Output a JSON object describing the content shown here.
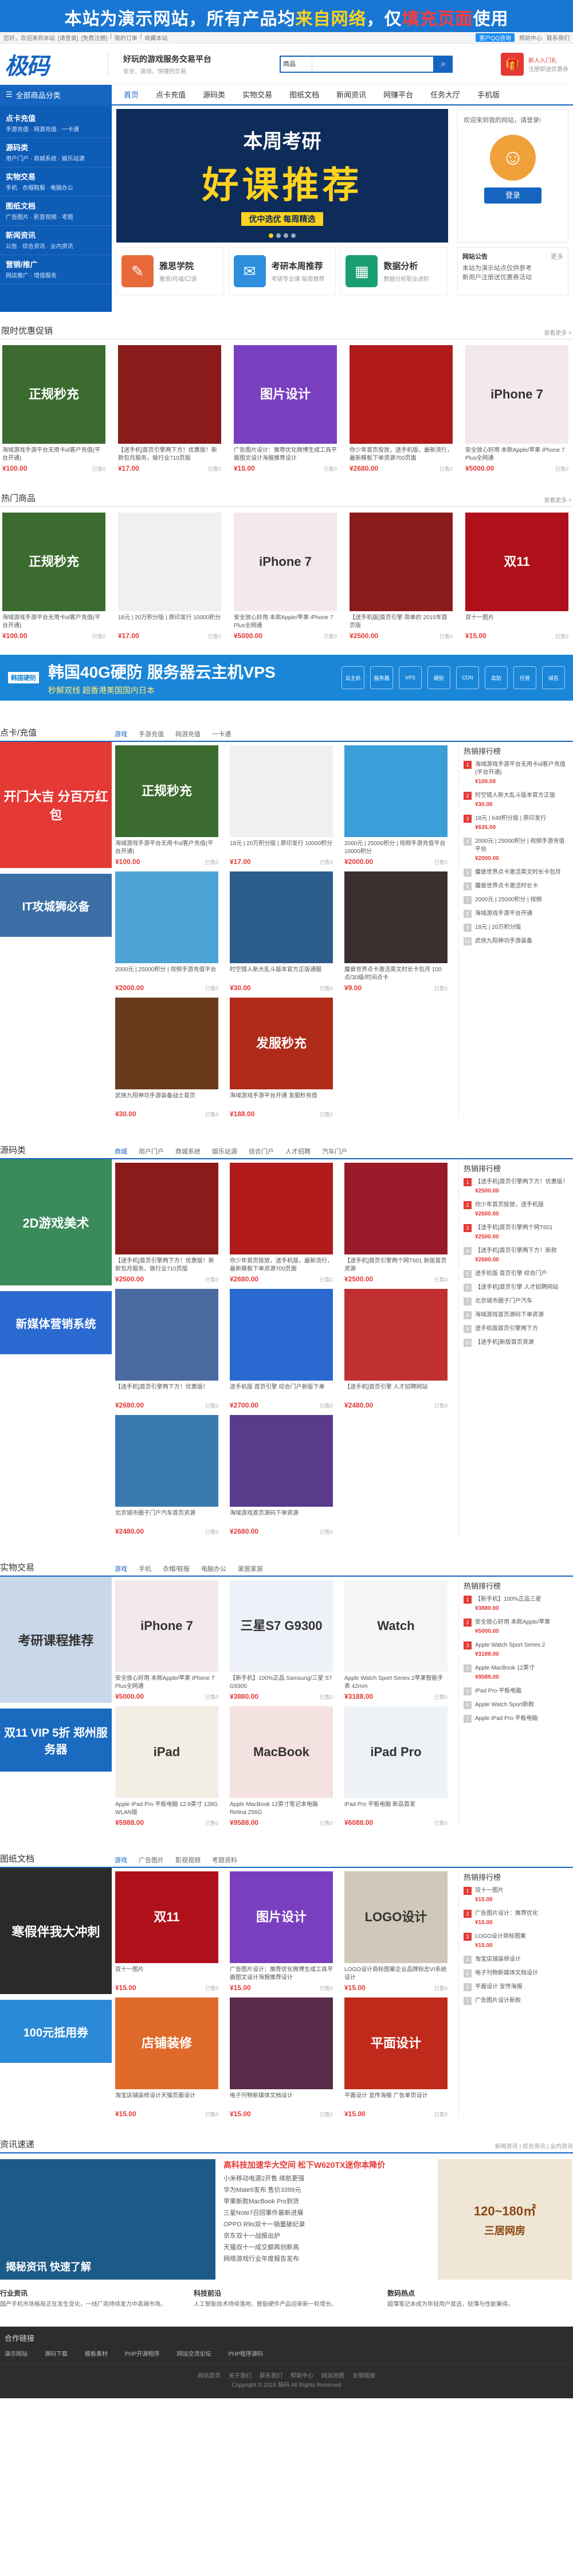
{
  "top_banner": {
    "part1": "本站为演示网站，所有产品均",
    "part2": "来自网络",
    "part3": "，仅",
    "part4": "填充页面",
    "part5": "使用"
  },
  "topbar": {
    "left": [
      "您好，欢迎来到本站",
      "[请登录]",
      "[免费注册]",
      "|",
      "我的订单",
      "|",
      "收藏本站"
    ],
    "qq_label": "客户QQ咨询",
    "right": [
      "帮助中心",
      "联系我们"
    ]
  },
  "header": {
    "logo": "极码",
    "slogan_title": "好玩的游戏服务交易平台",
    "slogan_sub": "安全、高效、快捷的交易",
    "search_select": "商品",
    "search_placeholder": "",
    "search_icon": "search-icon",
    "gift_label": "新人入门礼",
    "gift_sub": "注册即送优惠券"
  },
  "nav": {
    "category_label": "全部商品分类",
    "items": [
      "首页",
      "点卡充值",
      "源码类",
      "实物交易",
      "图纸文档",
      "新闻资讯",
      "网赚平台",
      "任务大厅",
      "手机版"
    ]
  },
  "sidecat": [
    {
      "title": "点卡充值",
      "sub": "手游充值 · 网游充值 · 一卡通"
    },
    {
      "title": "源码类",
      "sub": "用户门户 · 商城系统 · 娱乐站源"
    },
    {
      "title": "实物交易",
      "sub": "手机 · 衣帽鞋服 · 电脑办公"
    },
    {
      "title": "图纸文档",
      "sub": "广告图片 · 影音视频 · 考题"
    },
    {
      "title": "新闻资讯",
      "sub": "公告 · 综合资讯 · 业内资讯"
    },
    {
      "title": "营销/推广",
      "sub": "网店推广 · 增值服务"
    }
  ],
  "hero": {
    "line1": "本周考研",
    "line2": "好课推荐",
    "line3": "优中选优 每周精选",
    "tiles": [
      {
        "title": "雅思学院",
        "sub": "雅思/托福/口语",
        "color": "#e86a3a",
        "icon": "✎"
      },
      {
        "title": "考研本周推荐",
        "sub": "考研专业课 每周推荐",
        "color": "#2d8fde",
        "icon": "✉"
      },
      {
        "title": "数据分析",
        "sub": "数据分析职业进阶",
        "color": "#1a9e73",
        "icon": "▦"
      }
    ],
    "login_welcome": "欢迎来到我的网站，请登录!",
    "login_button": "登录",
    "notice_title": "网站公告",
    "notice_more": "更多",
    "notices": [
      "本站为演示站点仅供参考",
      "新用户注册送优惠券活动"
    ]
  },
  "limited": {
    "title": "限时优惠促销",
    "more": "查看更多 >",
    "items": [
      {
        "title": "海域游戏手游平台无用卡id客户充值(平台开通)",
        "price": "¥100.00",
        "sold": "已售0",
        "bg": "#3b6b2f",
        "label": "正规秒充"
      },
      {
        "title": "【送手机]首页引擎两下方！优惠版！新款包月服务，做行业710页版",
        "price": "¥17.00",
        "sold": "已售0",
        "bg": "#8b1a1a",
        "label": ""
      },
      {
        "title": "广告图片设计：推荐优化微博生成工具平面图文设计海报推荐设计",
        "price": "¥15.00",
        "sold": "已售0",
        "bg": "#7a3fbf",
        "label": "图片设计"
      },
      {
        "title": "你少年首页投放，送手机版，最新流行，最新模板下单资源700页面",
        "price": "¥2680.00",
        "sold": "已售0",
        "bg": "#b01a1a",
        "label": ""
      },
      {
        "title": "安全放心好用 本款Apple/苹果 iPhone 7 Plus全网通",
        "price": "¥5000.00",
        "sold": "已售0",
        "bg": "#f3e9ea",
        "label": "iPhone 7"
      }
    ]
  },
  "hot": {
    "title": "热门商品",
    "more": "查看更多 >",
    "items": [
      {
        "title": "海域游戏手游平台无用卡id客户充值(平台开通)",
        "price": "¥100.00",
        "sold": "已售0",
        "bg": "#3b6b2f",
        "label": "正规秒充"
      },
      {
        "title": "18元 | 20万积分版 | 原印发行 10000积分",
        "price": "¥17.00",
        "sold": "已售0",
        "bg": "#f0f0f0",
        "label": ""
      },
      {
        "title": "安全放心好用 本款Apple/苹果 iPhone 7 Plus全网通",
        "price": "¥5000.00",
        "sold": "已售0",
        "bg": "#f3e9ea",
        "label": "iPhone 7"
      },
      {
        "title": "【送手机版]首页引擎 简单的 2015年首页版",
        "price": "¥2500.00",
        "sold": "已售0",
        "bg": "#8b1a1a",
        "label": ""
      },
      {
        "title": "双十一图片",
        "price": "¥15.00",
        "sold": "已售0",
        "bg": "#b0101a",
        "label": "双11"
      }
    ]
  },
  "ad": {
    "tag": "韩国硬防",
    "big": "韩国40G硬防 服务器云主机VPS",
    "sub": "秒解双线 超香港美国国内日本",
    "icons": [
      "云主机",
      "服务器",
      "VPS",
      "硬防",
      "CDN",
      "高防",
      "托管",
      "域名"
    ]
  },
  "block_card": {
    "title": "点卡/充值",
    "tabs": [
      "游戏",
      "手游充值",
      "网游充值",
      "一卡通"
    ],
    "left1": "开门大吉 分百万红包",
    "left2": "IT攻城狮必备",
    "left1_bg": "#e53935",
    "left2_bg": "#3a6ea5",
    "items": [
      {
        "title": "海域游戏手游平台无用卡id客户充值(平台开通)",
        "price": "¥100.00",
        "sold": "已售0",
        "bg": "#3b6b2f",
        "label": "正规秒充"
      },
      {
        "title": "18元 | 20万积分版 | 原印发行 10000积分",
        "price": "¥17.00",
        "sold": "已售0",
        "bg": "#f0f0f0",
        "label": ""
      },
      {
        "title": "2000元 | 25000积分 | 视频手游充值平台 10000积分",
        "price": "¥2000.00",
        "sold": "已售0",
        "bg": "#3a9ed8",
        "label": ""
      },
      {
        "title": "2000元 | 25000积分 | 视频手游充值平台",
        "price": "¥2000.00",
        "sold": "已售0",
        "bg": "#4da3d6",
        "label": ""
      },
      {
        "title": "时空猎人新大乱斗版本官方正版通服",
        "price": "¥30.00",
        "sold": "已售0",
        "bg": "#2d5d8a",
        "label": ""
      },
      {
        "title": "魔兽世界点卡激活英文时长卡包月 100点/30级/时间点卡",
        "price": "¥9.00",
        "sold": "已售0",
        "bg": "#3a3030",
        "label": ""
      },
      {
        "title": "武侠九阳神功手游装备战士首页",
        "price": "¥30.00",
        "sold": "已售0",
        "bg": "#6a3a1a",
        "label": ""
      },
      {
        "title": "海域游戏手游平台开通 发服秒充值",
        "price": "¥188.00",
        "sold": "已售0",
        "bg": "#b02a1a",
        "label": "发服秒充"
      }
    ],
    "rank_title": "热销排行榜",
    "ranks": [
      {
        "name": "海域游戏手游平台无用卡id客户充值(平台开通)",
        "price": "¥100.00"
      },
      {
        "name": "时空猎人新大乱斗版本官方正版",
        "price": "¥30.00"
      },
      {
        "name": "18元 | 648积分版 | 原印发行",
        "price": "¥635.00"
      },
      {
        "name": "2000元 | 25000积分 | 视频手游充值平台",
        "price": "¥2000.00"
      },
      {
        "name": "魔兽世界点卡激活英文时长卡包月"
      },
      {
        "name": "魔兽世界点卡激活时长卡"
      },
      {
        "name": "2000元 | 25000积分 | 视频"
      },
      {
        "name": "海域游戏手游平台开通"
      },
      {
        "name": "18元 | 20万积分版"
      },
      {
        "name": "武侠九阳神功手游装备"
      }
    ]
  },
  "block_source": {
    "title": "源码类",
    "tabs": [
      "商城",
      "用户门户",
      "商城系统",
      "娱乐站源",
      "综合门户",
      "人才招聘",
      "汽车门户"
    ],
    "left1": "2D游戏美术",
    "left2": "新媒体营销系统",
    "left1_bg": "#3a8a5a",
    "left2_bg": "#2a6ad0",
    "items": [
      {
        "title": "【送手机]首页引擎两下方！优惠版！新款包月服务，做行业710页版",
        "price": "¥2500.00",
        "sold": "已售0",
        "bg": "#8b1a1a",
        "label": ""
      },
      {
        "title": "你少年首页投放，送手机版，最新流行，最新模板下单资源700页面",
        "price": "¥2680.00",
        "sold": "已售0",
        "bg": "#b01a1a",
        "label": ""
      },
      {
        "title": "【送手机]首页引擎两个网T601 新版首页资源",
        "price": "¥2500.00",
        "sold": "已售0",
        "bg": "#9a1a2a",
        "label": ""
      },
      {
        "title": "【送手机]首页引擎两下方！优惠版！",
        "price": "¥2680.00",
        "sold": "已售0",
        "bg": "#4a6aa0",
        "label": ""
      },
      {
        "title": "送手机版 首页引擎 综合门户新版下单",
        "price": "¥2700.00",
        "sold": "已售0",
        "bg": "#2a6ad0",
        "label": ""
      },
      {
        "title": "【送手机]首页引擎 人才招聘网站",
        "price": "¥2480.00",
        "sold": "已售0",
        "bg": "#c03030",
        "label": ""
      },
      {
        "title": "北京城市圈子门户汽车首页资源",
        "price": "¥2480.00",
        "sold": "已售0",
        "bg": "#3a7ab0",
        "label": ""
      },
      {
        "title": "海域游戏首页源码下单资源",
        "price": "¥2680.00",
        "sold": "已售0",
        "bg": "#5a3a8a",
        "label": ""
      }
    ],
    "rank_title": "热销排行榜",
    "ranks": [
      {
        "name": "【送手机]首页引擎两下方！优惠版！",
        "price": "¥2500.00"
      },
      {
        "name": "你少年首页投放，送手机版",
        "price": "¥2680.00"
      },
      {
        "name": "【送手机]首页引擎两个网T601",
        "price": "¥2500.00"
      },
      {
        "name": "【送手机]首页引擎两下方！新款",
        "price": "¥2680.00"
      },
      {
        "name": "送手机版 首页引擎 综合门户"
      },
      {
        "name": "【送手机]首页引擎 人才招聘网站"
      },
      {
        "name": "北京城市圈子门户汽车"
      },
      {
        "name": "海域游戏首页源码下单资源"
      },
      {
        "name": "送手机版首页引擎两下方"
      },
      {
        "name": "【送手机]新版首页资源"
      }
    ]
  },
  "block_goods": {
    "title": "实物交易",
    "tabs": [
      "游戏",
      "手机",
      "衣帽/鞋服",
      "电脑办公",
      "家居家装"
    ],
    "left1": "考研课程推荐",
    "left2": "双11 VIP 5折 郑州服务器",
    "left1_bg": "#c9d8e8",
    "left2_bg": "#1a6ac0",
    "items": [
      {
        "title": "安全放心好用 本款Apple/苹果 iPhone 7 Plus全网通",
        "price": "¥5000.00",
        "sold": "已售0",
        "bg": "#f3e9ea",
        "label": "iPhone 7"
      },
      {
        "title": "【新手机】100%正品 Samsung/三星 S7 G9300",
        "price": "¥3880.00",
        "sold": "已售0",
        "bg": "#eef1f7",
        "label": "三星S7 G9300"
      },
      {
        "title": "Apple Watch Sport Series 2苹果智能手表 42mm",
        "price": "¥3188.00",
        "sold": "已售0",
        "bg": "#f5f5f5",
        "label": "Watch"
      },
      {
        "title": "Apple iPad Pro 平板电脑 12.9英寸 128G WLAN版",
        "price": "¥5988.00",
        "sold": "已售0",
        "bg": "#f2eee4",
        "label": "iPad"
      },
      {
        "title": "Apple MacBook 12英寸笔记本电脑 Retina 256G",
        "price": "¥9588.00",
        "sold": "已售0",
        "bg": "#f4e2e0",
        "label": "MacBook"
      },
      {
        "title": "iPad Pro 平板电脑 新品首发",
        "price": "¥6088.00",
        "sold": "已售0",
        "bg": "#eef2f6",
        "label": "iPad Pro"
      }
    ],
    "rank_title": "热销排行榜",
    "ranks": [
      {
        "name": "【新手机】100%正品三星",
        "price": "¥3880.00"
      },
      {
        "name": "安全放心好用 本款Apple/苹果",
        "price": "¥5000.00"
      },
      {
        "name": "Apple Watch Sport Series 2",
        "price": "¥3188.00"
      },
      {
        "name": "Apple MacBook 12英寸",
        "price": "¥9588.00"
      },
      {
        "name": "iPad Pro 平板电脑"
      },
      {
        "name": "Apple Watch Sport新款"
      },
      {
        "name": "Apple iPad Pro 平板电脑"
      }
    ]
  },
  "block_docs": {
    "title": "图纸文档",
    "tabs": [
      "游戏",
      "广告图片",
      "影视视频",
      "考题资料"
    ],
    "left1": "寒假伴我大冲刺",
    "left2": "100元抵用券",
    "left1_bg": "#2a2a2a",
    "left2_bg": "#2a8ad8",
    "items": [
      {
        "title": "双十一图片",
        "price": "¥15.00",
        "sold": "已售0",
        "bg": "#b0101a",
        "label": "双11"
      },
      {
        "title": "广告图片设计：推荐优化微博生成工具平面图文设计海报推荐设计",
        "price": "¥15.00",
        "sold": "已售0",
        "bg": "#7a3fbf",
        "label": "图片设计"
      },
      {
        "title": "LOGO设计商标图案企业品牌标志VI系统设计",
        "price": "¥15.00",
        "sold": "已售0",
        "bg": "#d0c8b8",
        "label": "LOGO设计"
      },
      {
        "title": "淘宝店铺装修设计天猫页面设计",
        "price": "¥15.00",
        "sold": "已售0",
        "bg": "#e06a2a",
        "label": "店铺装修"
      },
      {
        "title": "电子刊物新媒体文档设计",
        "price": "¥15.00",
        "sold": "已售0",
        "bg": "#5a2a4a",
        "label": ""
      },
      {
        "title": "平面设计 宣传海报 广告单页设计",
        "price": "¥15.00",
        "sold": "已售0",
        "bg": "#c02a1a",
        "label": "平面设计"
      }
    ],
    "rank_title": "热销排行榜",
    "ranks": [
      {
        "name": "双十一图片",
        "price": "¥15.00"
      },
      {
        "name": "广告图片设计：推荐优化",
        "price": "¥15.00"
      },
      {
        "name": "LOGO设计商标图案",
        "price": "¥15.00"
      },
      {
        "name": "淘宝店铺装修设计"
      },
      {
        "name": "电子刊物新媒体文档设计"
      },
      {
        "name": "平面设计 宣传海报"
      },
      {
        "name": "广告图片设计新款"
      }
    ]
  },
  "news": {
    "title": "资讯速递",
    "more": "新闻资讯 | 综合资讯 | 业内资讯",
    "img_caption": "揭秘资讯 快速了解",
    "headline": "高科技加速华大空间 松下W620TX迷你本降价",
    "list": [
      "小米移动电源2开售 续航更强",
      "华为Mate9发布 售价3399元",
      "苹果新款MacBook Pro到货",
      "三星Note7召回事件最新进展",
      "OPPO R9s双十一销量破纪录",
      "京东双十一战报出炉",
      "天猫双十一成交额再创新高",
      "网络游戏行业年度报告发布"
    ],
    "ad_line1": "120~180㎡",
    "ad_line2": "三居网房",
    "bottom": [
      {
        "h": "行业资讯",
        "t": "国产手机市场格局正在发生变化，一线厂商持续发力中高端市场。"
      },
      {
        "h": "科技前沿",
        "t": "人工智能技术持续落地，智能硬件产品迎来新一轮增长。"
      },
      {
        "h": "数码热点",
        "t": "超薄笔记本成为年轻用户首选，轻薄与性能兼得。"
      }
    ]
  },
  "partners": {
    "title": "合作链接",
    "links": [
      "演示网站",
      "源码下载",
      "模板素材",
      "PHP开源程序",
      "网站交流论坛",
      "PHP程序源码"
    ]
  },
  "footer": {
    "links": [
      "网站首页",
      "关于我们",
      "联系我们",
      "帮助中心",
      "网站地图",
      "友情链接"
    ],
    "copyright": "Copyright © 2016 极码 All Rights Reserved"
  }
}
